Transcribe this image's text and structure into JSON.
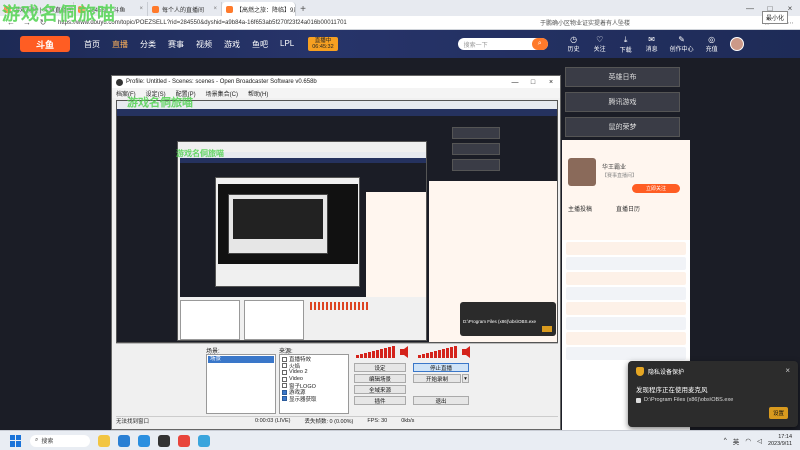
{
  "watermark": "游戏名侗旅喵",
  "browser": {
    "tabs": [
      {
        "label": "游戏视频 | 斗鱼直播间推荐"
      },
      {
        "label": "284550 - 斗鱼"
      },
      {
        "label": "每个人的直播间"
      },
      {
        "label": "【高燃之旅：降临】9月11日开..."
      }
    ],
    "new_tab": "+",
    "tooltip": "最小化",
    "url": "https://www.douyu.com/topic/POEZSELL?rid=284550&dyshid=a9b84a-16f653ab5f270f23f24a016b00011701",
    "extension_note": "于鹏确小区物业证实提着有人坠楼",
    "back": "←",
    "forward": "→",
    "reload": "↻"
  },
  "douyu": {
    "logo": "斗鱼",
    "nav": [
      "首页",
      "直播",
      "分类",
      "赛事",
      "视频",
      "游戏",
      "鱼吧",
      "LPL"
    ],
    "live_badge": "直播中",
    "live_time": "06:45:32",
    "search_placeholder": "搜索一下",
    "header_icons": [
      "历史",
      "关注",
      "下载",
      "消息",
      "创作中心",
      "充值"
    ],
    "side_buttons": [
      "英雄日布",
      "腾讯游戏",
      "鼠的荣梦"
    ],
    "anchor": {
      "name": "华王霸业",
      "sub": "【赛事直播间】",
      "follow": "立即关注",
      "tabs": [
        "主播投稿",
        "直播日历"
      ]
    }
  },
  "privacy": {
    "title": "隐私设备保护",
    "message": "发现程序正在使用麦克风",
    "path": "D:\\Program Files (x86)\\obs\\OBS.exe",
    "settings": "设置"
  },
  "obs": {
    "title": "Profile: Untitled - Scenes: scenes - Open Broadcaster Software v0.658b",
    "menu": [
      "档案(F)",
      "设定(S)",
      "配置(P)",
      "场景集合(C)",
      "帮助(H)"
    ],
    "scenes_label": "场景:",
    "scenes": [
      "场景"
    ],
    "sources_label": "来源:",
    "sources": [
      {
        "label": "直播特效",
        "on": false
      },
      {
        "label": "火焰",
        "on": false
      },
      {
        "label": "Video 2",
        "on": false
      },
      {
        "label": "Video",
        "on": false
      },
      {
        "label": "窗子LOGO",
        "on": false
      },
      {
        "label": "游戏源",
        "on": true
      },
      {
        "label": "显示器获取",
        "on": true
      }
    ],
    "buttons": {
      "settings": "设定",
      "stop_stream": "停止直播",
      "edit_scene": "编辑场景",
      "start_record": "开始录制",
      "global_sources": "全域来源",
      "plugins": "插件",
      "exit": "退出"
    },
    "status": {
      "left": "无法找到窗口",
      "time": "0:00:03 (LIVE)",
      "dropped": "丢失帧数: 0 (0.00%)",
      "fps": "FPS: 30",
      "bitrate": "0kb/s"
    },
    "notification": "D:\\Program Files (x86)\\obs\\OBS.exe"
  },
  "taskbar": {
    "search": "搜索",
    "ime": "英",
    "time": "17:14",
    "date": "2023/9/11"
  }
}
